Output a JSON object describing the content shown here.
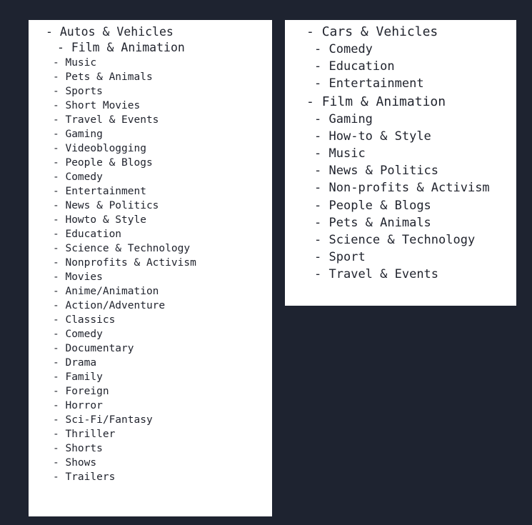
{
  "page": {
    "background_color": "#1e2330",
    "panel_background_color": "#ffffff",
    "text_color": "#21242e"
  },
  "panels": [
    {
      "name": "left-category-panel",
      "items": [
        {
          "bullet": "-",
          "label": "Autos & Vehicles",
          "size": "big",
          "indent": 0
        },
        {
          "bullet": "-",
          "label": "Film & Animation",
          "size": "big",
          "indent": 1
        },
        {
          "bullet": "-",
          "label": "Music",
          "size": "regular",
          "indent": 0
        },
        {
          "bullet": "-",
          "label": "Pets & Animals",
          "size": "regular",
          "indent": 0
        },
        {
          "bullet": "-",
          "label": "Sports",
          "size": "regular",
          "indent": 0
        },
        {
          "bullet": "-",
          "label": "Short Movies",
          "size": "regular",
          "indent": 0
        },
        {
          "bullet": "-",
          "label": "Travel & Events",
          "size": "regular",
          "indent": 0
        },
        {
          "bullet": "-",
          "label": "Gaming",
          "size": "regular",
          "indent": 0
        },
        {
          "bullet": "-",
          "label": "Videoblogging",
          "size": "regular",
          "indent": 0
        },
        {
          "bullet": "-",
          "label": "People & Blogs",
          "size": "regular",
          "indent": 0
        },
        {
          "bullet": "-",
          "label": "Comedy",
          "size": "regular",
          "indent": 0
        },
        {
          "bullet": "-",
          "label": "Entertainment",
          "size": "regular",
          "indent": 0
        },
        {
          "bullet": "-",
          "label": "News & Politics",
          "size": "regular",
          "indent": 0
        },
        {
          "bullet": "-",
          "label": "Howto & Style",
          "size": "regular",
          "indent": 0
        },
        {
          "bullet": "-",
          "label": "Education",
          "size": "regular",
          "indent": 0
        },
        {
          "bullet": "-",
          "label": "Science & Technology",
          "size": "regular",
          "indent": 0
        },
        {
          "bullet": "-",
          "label": "Nonprofits & Activism",
          "size": "regular",
          "indent": 0
        },
        {
          "bullet": "-",
          "label": "Movies",
          "size": "regular",
          "indent": 0
        },
        {
          "bullet": "-",
          "label": "Anime/Animation",
          "size": "regular",
          "indent": 0
        },
        {
          "bullet": "-",
          "label": "Action/Adventure",
          "size": "regular",
          "indent": 0
        },
        {
          "bullet": "-",
          "label": "Classics",
          "size": "regular",
          "indent": 0
        },
        {
          "bullet": "-",
          "label": "Comedy",
          "size": "regular",
          "indent": 0
        },
        {
          "bullet": "-",
          "label": "Documentary",
          "size": "regular",
          "indent": 0
        },
        {
          "bullet": "-",
          "label": "Drama",
          "size": "regular",
          "indent": 0
        },
        {
          "bullet": "-",
          "label": "Family",
          "size": "regular",
          "indent": 0
        },
        {
          "bullet": "-",
          "label": "Foreign",
          "size": "regular",
          "indent": 0
        },
        {
          "bullet": "-",
          "label": "Horror",
          "size": "regular",
          "indent": 0
        },
        {
          "bullet": "-",
          "label": "Sci-Fi/Fantasy",
          "size": "regular",
          "indent": 0
        },
        {
          "bullet": "-",
          "label": "Thriller",
          "size": "regular",
          "indent": 0
        },
        {
          "bullet": "-",
          "label": "Shorts",
          "size": "regular",
          "indent": 0
        },
        {
          "bullet": "-",
          "label": "Shows",
          "size": "regular",
          "indent": 0
        },
        {
          "bullet": "-",
          "label": "Trailers",
          "size": "regular",
          "indent": 0
        }
      ]
    },
    {
      "name": "right-category-panel",
      "items": [
        {
          "bullet": "-",
          "label": "Cars & Vehicles",
          "size": "big",
          "indent": 0
        },
        {
          "bullet": "-",
          "label": "Comedy",
          "size": "regular",
          "indent": 0
        },
        {
          "bullet": "-",
          "label": "Education",
          "size": "regular",
          "indent": 0
        },
        {
          "bullet": "-",
          "label": "Entertainment",
          "size": "regular",
          "indent": 0
        },
        {
          "bullet": "-",
          "label": "Film & Animation",
          "size": "big",
          "indent": 0
        },
        {
          "bullet": "-",
          "label": "Gaming",
          "size": "regular",
          "indent": 0
        },
        {
          "bullet": "-",
          "label": "How-to & Style",
          "size": "regular",
          "indent": 0
        },
        {
          "bullet": "-",
          "label": "Music",
          "size": "regular",
          "indent": 0
        },
        {
          "bullet": "-",
          "label": "News & Politics",
          "size": "regular",
          "indent": 0
        },
        {
          "bullet": "-",
          "label": "Non-profits & Activism",
          "size": "regular",
          "indent": 0
        },
        {
          "bullet": "-",
          "label": "People & Blogs",
          "size": "regular",
          "indent": 0
        },
        {
          "bullet": "-",
          "label": "Pets & Animals",
          "size": "regular",
          "indent": 0
        },
        {
          "bullet": "-",
          "label": "Science & Technology",
          "size": "regular",
          "indent": 0
        },
        {
          "bullet": "-",
          "label": "Sport",
          "size": "regular",
          "indent": 0
        },
        {
          "bullet": "-",
          "label": "Travel & Events",
          "size": "regular",
          "indent": 0
        }
      ]
    }
  ]
}
